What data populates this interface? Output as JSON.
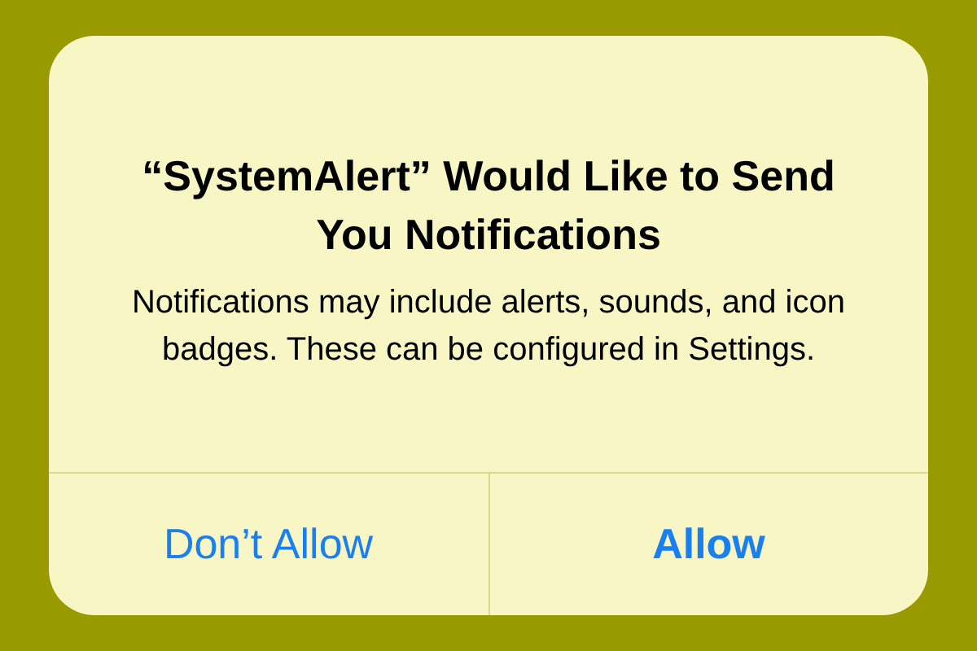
{
  "alert": {
    "title": "“SystemAlert” Would Like to Send You Notifications",
    "message": "Notifications may include alerts, sounds, and icon badges. These can be configured in Settings.",
    "buttons": [
      {
        "label": "Don’t Allow",
        "kind": "cancel"
      },
      {
        "label": "Allow",
        "kind": "default"
      }
    ]
  }
}
